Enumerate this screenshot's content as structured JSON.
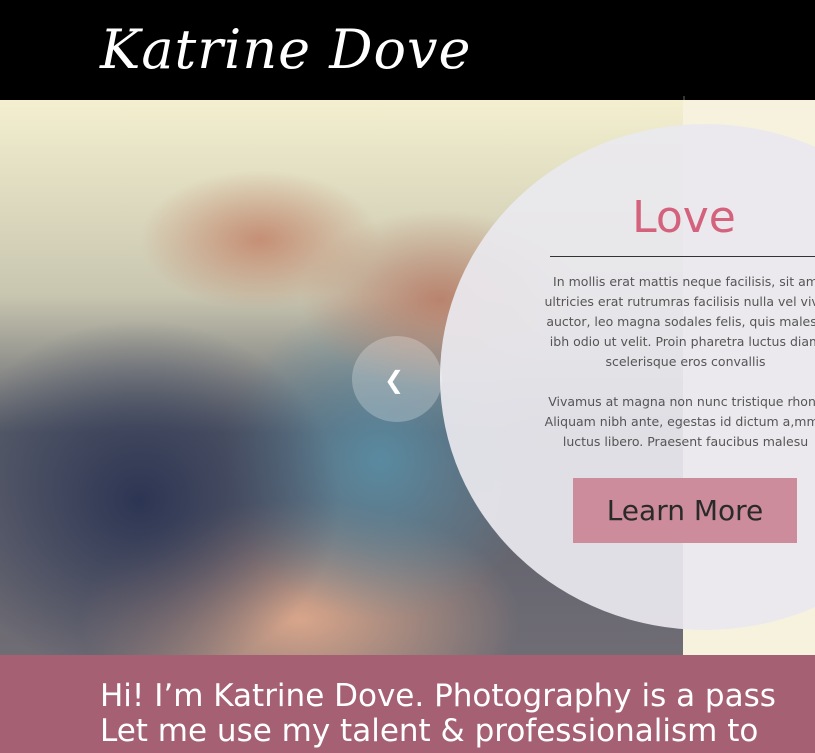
{
  "site": {
    "logo": "Katrine Dove"
  },
  "hero": {
    "slide": {
      "title": "Love",
      "text": "In mollis erat mattis neque facilisis, sit am\nultricies erat rutrumras facilisis nulla vel vive\nauctor, leo magna sodales felis, quis malesu\nibh odio ut velit. Proin pharetra luctus diam\nscelerisque eros convallis\n\nVivamus at magna non nunc tristique rhonc\nAliquam nibh ante, egestas id dictum a,mme\nluctus libero. Praesent faucibus malesu",
      "button_label": "Learn More"
    },
    "prev_icon": "chevron-left-icon"
  },
  "intro": {
    "line1": "Hi! I’m Katrine Dove. Photography is a pass",
    "line2": "Let me use my talent & professionalism to"
  },
  "colors": {
    "header_bg": "#000000",
    "accent_pink": "#d4627d",
    "button_bg": "#cd8c9c",
    "intro_bg": "#a66074"
  }
}
